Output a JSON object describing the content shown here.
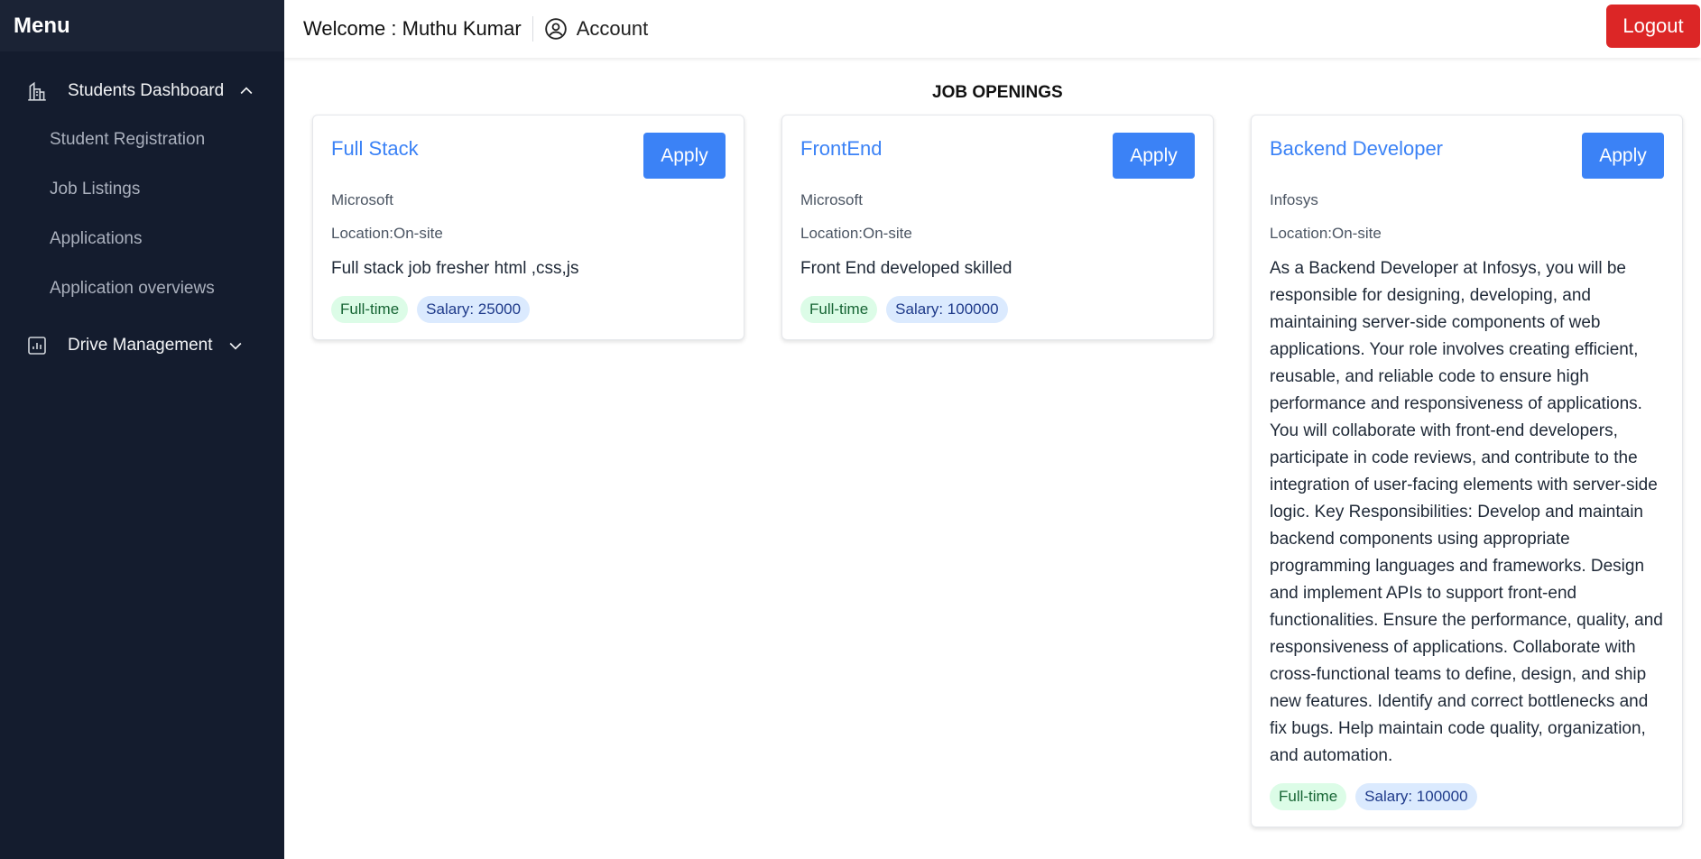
{
  "sidebar": {
    "title": "Menu",
    "groups": [
      {
        "label": "Students Dashboard",
        "icon": "building-chart-icon",
        "expanded": true,
        "items": [
          {
            "label": "Student Registration"
          },
          {
            "label": "Job Listings"
          },
          {
            "label": "Applications"
          },
          {
            "label": "Application overviews"
          }
        ]
      },
      {
        "label": "Drive Management",
        "icon": "bar-chart-icon",
        "expanded": false
      }
    ]
  },
  "header": {
    "welcome": "Welcome : Muthu Kumar",
    "account_label": "Account",
    "logout_label": "Logout"
  },
  "main": {
    "section_title": "JOB OPENINGS",
    "jobs": [
      {
        "title": "Full Stack",
        "apply_label": "Apply",
        "company": "Microsoft",
        "location": "Location:On-site",
        "description": "Full stack job fresher html ,css,js",
        "type": "Full-time",
        "salary": "Salary: 25000"
      },
      {
        "title": "FrontEnd",
        "apply_label": "Apply",
        "company": "Microsoft",
        "location": "Location:On-site",
        "description": "Front End developed skilled",
        "type": "Full-time",
        "salary": "Salary: 100000"
      },
      {
        "title": "Backend Developer",
        "apply_label": "Apply",
        "company": "Infosys",
        "location": "Location:On-site",
        "description": "As a Backend Developer at Infosys, you will be responsible for designing, developing, and maintaining server-side components of web applications. Your role involves creating efficient, reusable, and reliable code to ensure high performance and responsiveness of applications. You will collaborate with front-end developers, participate in code reviews, and contribute to the integration of user-facing elements with server-side logic. Key Responsibilities: Develop and maintain backend components using appropriate programming languages and frameworks. Design and implement APIs to support front-end functionalities. Ensure the performance, quality, and responsiveness of applications. Collaborate with cross-functional teams to define, design, and ship new features. Identify and correct bottlenecks and fix bugs. Help maintain code quality, organization, and automation.",
        "type": "Full-time",
        "salary": "Salary: 100000"
      }
    ]
  },
  "colors": {
    "sidebar_bg": "#141c2e",
    "accent": "#3b82f6",
    "logout": "#dc2626",
    "tag_type_bg": "#dcfce7",
    "tag_salary_bg": "#dbeafe"
  }
}
